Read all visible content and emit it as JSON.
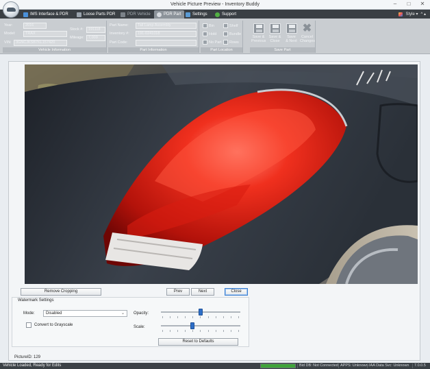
{
  "window": {
    "title": "Vehicle Picture Preview - Inventory Buddy",
    "controls": [
      "–",
      "□",
      "✕"
    ]
  },
  "tabs": [
    {
      "label": "IMS Interface & PDR",
      "state": "normal",
      "icon": "ims-icon"
    },
    {
      "label": "Loose Parts PDR",
      "state": "normal",
      "icon": "loose-parts-icon"
    },
    {
      "label": "PDR Vehicle",
      "state": "disabled",
      "icon": "vehicle-icon"
    },
    {
      "label": "PDR Part",
      "state": "active",
      "icon": "part-icon"
    },
    {
      "label": "Settings",
      "state": "normal",
      "icon": "settings-icon"
    },
    {
      "label": "Support",
      "state": "normal",
      "icon": "support-icon"
    }
  ],
  "style_menu": {
    "label": "Style ▾",
    "extra": "^ ▴"
  },
  "ribbon": {
    "vehicle_info": {
      "caption": "Vehicle Information",
      "year_label": "Year:",
      "year": "2016",
      "model_label": "Model:",
      "model": "TRAX",
      "stock_label": "Stock #:",
      "stock": "191118",
      "mileage_label": "Mileage:",
      "mileage": "7,009",
      "vin_label": "VIN:",
      "vin": "3GNCJKSB7KL157420"
    },
    "part_info": {
      "caption": "Part Information",
      "part_name_label": "Part Name:",
      "part_name": "Tail Lamp Assembly",
      "inventory_label": "Inventory #:",
      "inventory": "191-0241018",
      "part_code_label": "Part Code:",
      "part_code": ""
    },
    "part_location": {
      "caption": "Part Location",
      "buttons": [
        "Bin",
        "Shelf",
        "Hold",
        "Bundle",
        "No Part",
        "Rows"
      ]
    },
    "save_part": {
      "caption": "Save Part",
      "buttons": [
        {
          "line1": "Save &",
          "line2": "Previous"
        },
        {
          "line1": "Save &",
          "line2": "Close"
        },
        {
          "line1": "Save",
          "line2": "& Next"
        },
        {
          "line1": "Cancel",
          "line2": "Changes"
        }
      ]
    }
  },
  "actions": {
    "remove_cropping": "Remove Cropping",
    "prev": "Prev",
    "next": "Next",
    "close": "Close"
  },
  "watermark": {
    "title": "Watermark Settings",
    "mode_label": "Mode:",
    "mode_value": "Disabled",
    "grayscale_label": "Convert to Grayscale",
    "grayscale_checked": false,
    "opacity_label": "Opacity:",
    "opacity_level": 0.5,
    "scale_label": "Scale:",
    "scale_level": 0.4,
    "reset_label": "Reset to Defaults"
  },
  "picture_id": "PictureID: 129",
  "status": {
    "message": "Vehicle Loaded, Ready for Edits",
    "progress": 1.0,
    "segments": [
      "Bid DB: Not Connected",
      "APPS: Unknown",
      "IAA Data Svc: Unknown",
      "7.0.0.5"
    ]
  },
  "colors": {
    "tabbar": "#3a3f44",
    "ribbon": "#c9cdd1",
    "statusbar": "#3b4146",
    "accent": "#2e6fc7"
  }
}
